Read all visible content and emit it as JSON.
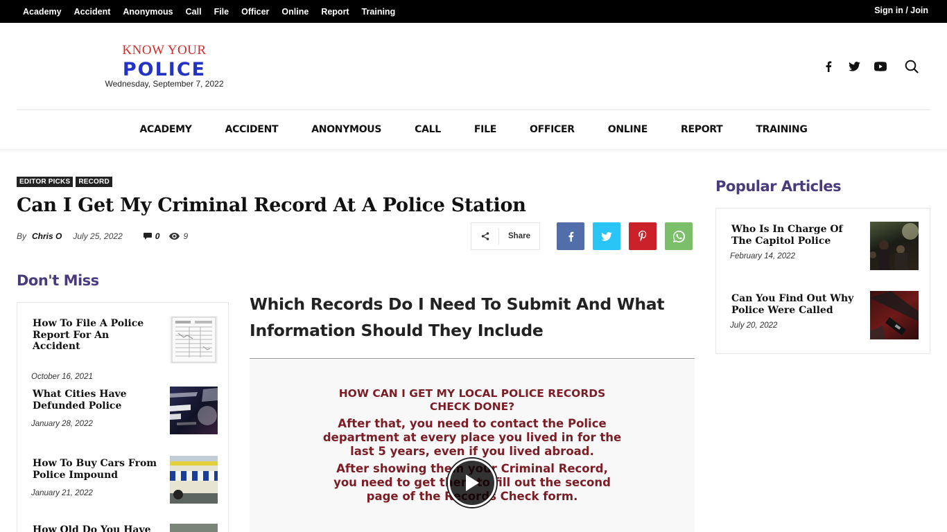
{
  "topbar": {
    "menu": [
      "Academy",
      "Accident",
      "Anonymous",
      "Call",
      "File",
      "Officer",
      "Online",
      "Report",
      "Training"
    ],
    "signin": "Sign in / Join"
  },
  "logo": {
    "top": "KNOW YOUR",
    "main": "POLICE",
    "date": "Wednesday, September 7, 2022"
  },
  "header_icons": [
    "facebook-icon",
    "twitter-icon",
    "youtube-icon",
    "search-icon"
  ],
  "mainnav": [
    "ACADEMY",
    "ACCIDENT",
    "ANONYMOUS",
    "CALL",
    "FILE",
    "OFFICER",
    "ONLINE",
    "REPORT",
    "TRAINING"
  ],
  "article": {
    "categories": [
      "EDITOR PICKS",
      "RECORD"
    ],
    "title": "Can I Get My Criminal Record At A Police Station",
    "by": "By",
    "author": "Chris O",
    "date": "July 25, 2022",
    "comments": "0",
    "views": "9",
    "share_label": "Share",
    "share_buttons": [
      {
        "name": "facebook",
        "color": "#516eab"
      },
      {
        "name": "twitter",
        "color": "#29c5f6"
      },
      {
        "name": "pinterest",
        "color": "#ca212a"
      },
      {
        "name": "whatsapp",
        "color": "#7bbf6a"
      }
    ],
    "subheading": "Which Records Do I Need To Submit And What Information Should They Include",
    "video_text": [
      "HOW CAN I GET MY LOCAL POLICE RECORDS",
      "CHECK DONE?",
      "After that, you need to contact the Police",
      "department at every place you lived in for the",
      "last 5 years, even if you lived abroad.",
      "After showing them your Criminal Record,",
      "you need to get them to fill out the second",
      "page of the Records Check form."
    ]
  },
  "dont_miss": {
    "title": "Don't Miss",
    "items": [
      {
        "title": "How To File A Police Report For An Accident",
        "date": "October 16, 2021"
      },
      {
        "title": "What Cities Have Defunded Police",
        "date": "January 28, 2022"
      },
      {
        "title": "How To Buy Cars From Police Impound",
        "date": "January 21, 2022"
      },
      {
        "title": "How Old Do You Have",
        "date": ""
      }
    ]
  },
  "popular": {
    "title": "Popular Articles",
    "items": [
      {
        "title": "Who Is In Charge Of The Capitol Police",
        "date": "February 14, 2022"
      },
      {
        "title": "Can You Find Out Why Police Were Called",
        "date": "July 20, 2022"
      }
    ]
  },
  "colors": {
    "accent_purple": "#4a3b7c",
    "logo_red": "#d42a2a",
    "logo_blue": "#2334c4",
    "video_text": "#7c1d25"
  }
}
